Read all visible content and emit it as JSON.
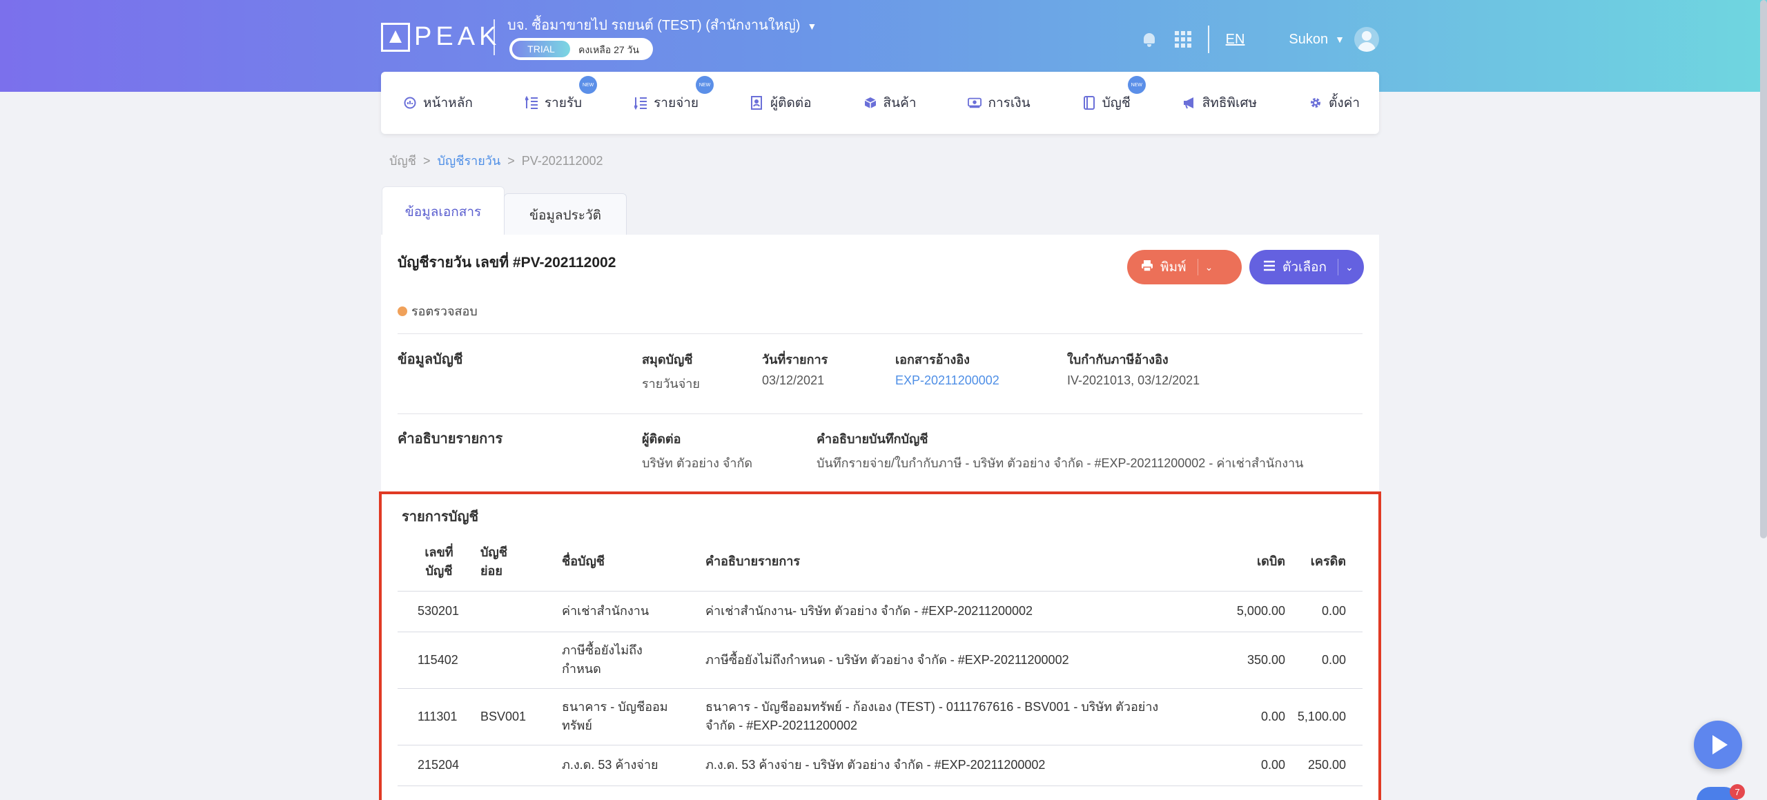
{
  "header": {
    "logo_text": "PEAK",
    "company_name": "บจ. ซื้อมาขายไป รถยนต์ (TEST) (สำนักงานใหญ่)",
    "trial_label": "TRIAL",
    "trial_remaining": "คงเหลือ 27 วัน",
    "language": "EN",
    "user_name": "Sukon"
  },
  "nav": {
    "home": "หน้าหลัก",
    "income": "รายรับ",
    "expense": "รายจ่าย",
    "contacts": "ผู้ติดต่อ",
    "products": "สินค้า",
    "finance": "การเงิน",
    "accounting": "บัญชี",
    "privileges": "สิทธิพิเศษ",
    "settings": "ตั้งค่า",
    "new_badge": "NEW"
  },
  "breadcrumb": {
    "root": "บัญชี",
    "sep": ">",
    "journal": "บัญชีรายวัน",
    "current": "PV-202112002"
  },
  "tabs": {
    "document": "ข้อมูลเอกสาร",
    "history": "ข้อมูลประวัติ"
  },
  "document": {
    "title": "บัญชีรายวัน เลขที่ #PV-202112002",
    "print_label": "พิมพ์",
    "options_label": "ตัวเลือก",
    "status": "รอตรวจสอบ"
  },
  "account_info": {
    "section_title": "ข้อมูลบัญชี",
    "journal_label": "สมุดบัญชี",
    "journal_value": "รายวันจ่าย",
    "date_label": "วันที่รายการ",
    "date_value": "03/12/2021",
    "ref_doc_label": "เอกสารอ้างอิง",
    "ref_doc_value": "EXP-20211200002",
    "tax_inv_label": "ใบกำกับภาษีอ้างอิง",
    "tax_inv_value": "IV-2021013, 03/12/2021"
  },
  "description": {
    "section_title": "คำอธิบายรายการ",
    "contact_label": "ผู้ติดต่อ",
    "contact_value": "บริษัท ตัวอย่าง จำกัด",
    "note_label": "คำอธิบายบันทึกบัญชี",
    "note_value": "บันทึกรายจ่าย/ใบกำกับภาษี - บริษัท ตัวอย่าง จำกัด - #EXP-20211200002 - ค่าเช่าสำนักงาน"
  },
  "entries": {
    "section_title": "รายการบัญชี",
    "headers": {
      "account_no_1": "เลขที่",
      "account_no_2": "บัญชี",
      "sub_1": "บัญชี",
      "sub_2": "ย่อย",
      "account_name": "ชื่อบัญชี",
      "description": "คำอธิบายรายการ",
      "debit": "เดบิต",
      "credit": "เครดิต"
    },
    "rows": [
      {
        "no": "530201",
        "sub": "",
        "name": "ค่าเช่าสำนักงาน",
        "desc": "ค่าเช่าสำนักงาน- บริษัท ตัวอย่าง จำกัด - #EXP-20211200002",
        "debit": "5,000.00",
        "credit": "0.00"
      },
      {
        "no": "115402",
        "sub": "",
        "name": "ภาษีซื้อยังไม่ถึงกำหนด",
        "desc": "ภาษีซื้อยังไม่ถึงกำหนด - บริษัท ตัวอย่าง จำกัด - #EXP-20211200002",
        "debit": "350.00",
        "credit": "0.00"
      },
      {
        "no": "111301",
        "sub": "BSV001",
        "name": "ธนาคาร - บัญชีออมทรัพย์",
        "desc": "ธนาคาร - บัญชีออมทรัพย์ - ก้องเอง (TEST) - 0111767616 - BSV001 - บริษัท ตัวอย่าง จำกัด - #EXP-20211200002",
        "debit": "0.00",
        "credit": "5,100.00"
      },
      {
        "no": "215204",
        "sub": "",
        "name": "ภ.ง.ด. 53 ค้างจ่าย",
        "desc": "ภ.ง.ด. 53 ค้างจ่าย - บริษัท ตัวอย่าง จำกัด - #EXP-20211200002",
        "debit": "0.00",
        "credit": "250.00"
      }
    ]
  },
  "chat_badge": "7",
  "colors": {
    "brand_gradient_start": "#7b70ec",
    "brand_gradient_end": "#6fd6e0",
    "print_button": "#ec7058",
    "options_button": "#6461e0",
    "highlight_border": "#e03a24",
    "link": "#4f8fe6",
    "status_dot": "#f0a15a"
  }
}
